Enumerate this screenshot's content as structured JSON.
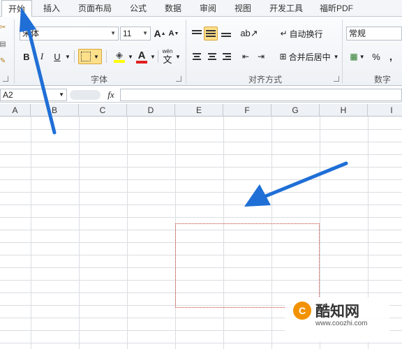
{
  "tabs": [
    "开始",
    "插入",
    "页面布局",
    "公式",
    "数据",
    "审阅",
    "视图",
    "开发工具",
    "福昕PDF"
  ],
  "font": {
    "name": "宋体",
    "size": "11",
    "grow_label": "A",
    "shrink_label": "A",
    "bold": "B",
    "italic": "I",
    "underline": "U",
    "font_color_label": "A",
    "wen_label_top": "wén",
    "wen_label": "文",
    "group_label": "字体"
  },
  "alignment": {
    "wrap_text": "自动换行",
    "merge_center": "合并后居中",
    "group_label": "对齐方式"
  },
  "number": {
    "format": "常规",
    "percent": "%",
    "comma": ",",
    "group_label": "数字"
  },
  "formula_bar": {
    "name_box": "A2",
    "fx": "fx",
    "content": ""
  },
  "columns": [
    "A",
    "B",
    "C",
    "D",
    "E",
    "F",
    "G",
    "H",
    "I"
  ],
  "watermark": {
    "logo": "C",
    "title": "酷知网",
    "url": "www.coozhi.com"
  },
  "colors": {
    "arrow": "#1f6fd6",
    "marquee": "#c0392b",
    "highlight": "#fde08a",
    "accent_orange": "#f39200"
  }
}
